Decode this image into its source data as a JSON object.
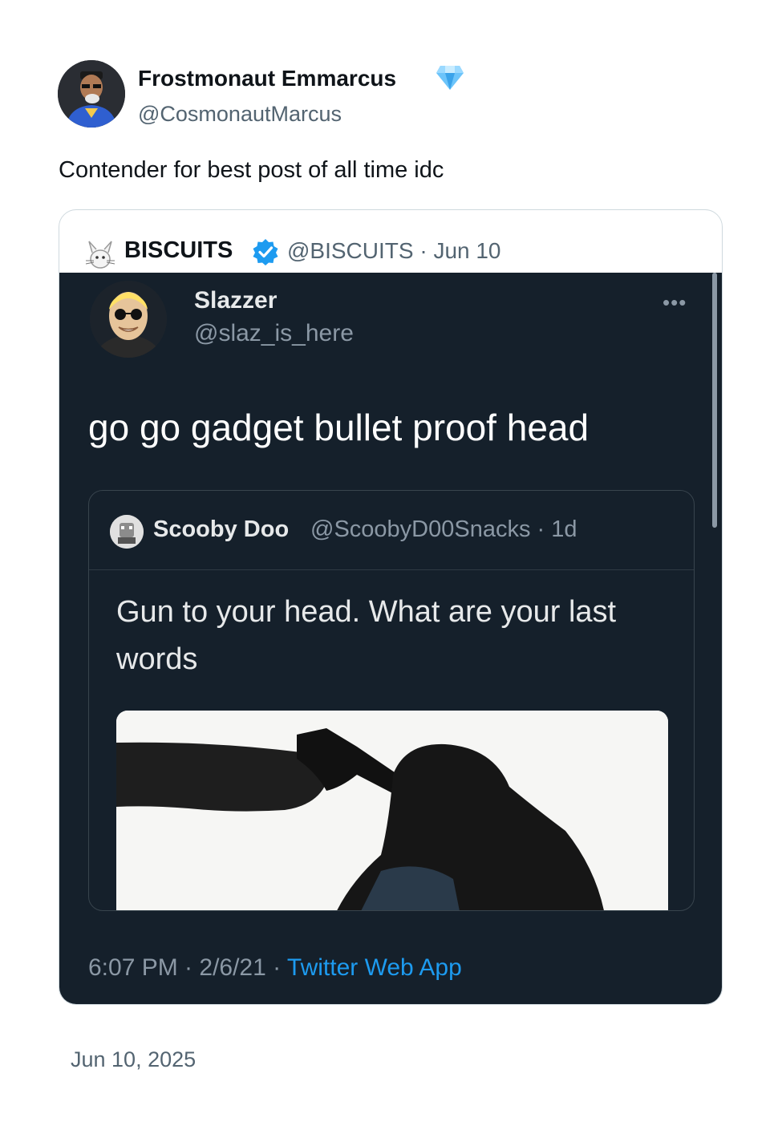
{
  "post": {
    "author_name": "Frostmonaut Emmarcus",
    "author_badge_icon": "diamond-icon",
    "author_handle": "@CosmonautMarcus",
    "text": "Contender for best post of all time idc",
    "date": "Jun 10, 2025"
  },
  "quoted": {
    "name": "BISCUITS",
    "verified_icon": "verified-badge-icon",
    "meta": "@BISCUITS · Jun 10",
    "screenshot": {
      "author_name": "Slazzer",
      "author_handle": "@slaz_is_here",
      "more_glyph": "•••",
      "text": "go go gadget bullet proof head",
      "nested": {
        "name": "Scooby Doo",
        "meta": "@ScoobyD00Snacks · 1d",
        "text": "Gun to your head. What are your last words"
      },
      "footer_time": "6:07 PM · 2/6/21 · ",
      "footer_app": "Twitter Web App"
    }
  },
  "colors": {
    "verified_blue": "#1d9bf0",
    "diamond_blue": "#5ab3f5",
    "dark_bg": "#15202b"
  }
}
